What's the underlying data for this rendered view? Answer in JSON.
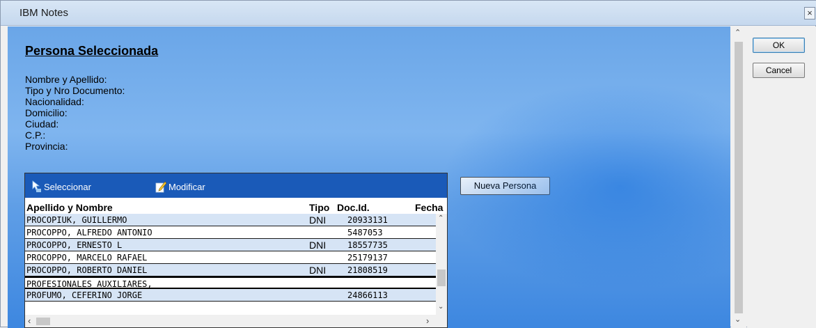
{
  "window": {
    "title": "IBM Notes",
    "close_glyph": "×"
  },
  "dialog": {
    "section_title": "Persona Seleccionada",
    "fields": [
      "Nombre y Apellido:",
      "Tipo y Nro Documento:",
      "Nacionalidad:",
      "Domicilio:",
      "Ciudad:",
      "C.P.:",
      "Provincia:"
    ],
    "toolbar": {
      "select_label": "Seleccionar",
      "modify_label": "Modificar"
    },
    "columns": {
      "name": "Apellido y Nombre",
      "tipo": "Tipo",
      "doc": "Doc.Id.",
      "fecha": "Fecha"
    },
    "rows": [
      {
        "name": "PROCOPIUK, GUILLERMO",
        "tipo": "DNI",
        "doc": "20933131"
      },
      {
        "name": "PROCOPPO, ALFREDO ANTONIO",
        "tipo": "",
        "doc": "5487053"
      },
      {
        "name": "PROCOPPO, ERNESTO L",
        "tipo": "DNI",
        "doc": "18557735"
      },
      {
        "name": "PROCOPPO, MARCELO RAFAEL",
        "tipo": "",
        "doc": "25179137"
      },
      {
        "name": "PROCOPPO, ROBERTO DANIEL",
        "tipo": "DNI",
        "doc": "21808519"
      },
      {
        "name": "PROFESIONALES AUXILIARES,",
        "tipo": "",
        "doc": ""
      },
      {
        "name": "PROFUMO, CEFERINO JORGE",
        "tipo": "",
        "doc": "24866113"
      }
    ],
    "new_person_label": "Nueva Persona"
  },
  "buttons": {
    "ok_label": "OK",
    "cancel_label": "Cancel"
  },
  "icons": {
    "select": "pointer-select-icon",
    "modify": "edit-pencil-icon"
  },
  "colors": {
    "toolbar": "#1a5ab8",
    "row_alt": "#d6e4f5",
    "background_blue": "#6aa6e8"
  }
}
